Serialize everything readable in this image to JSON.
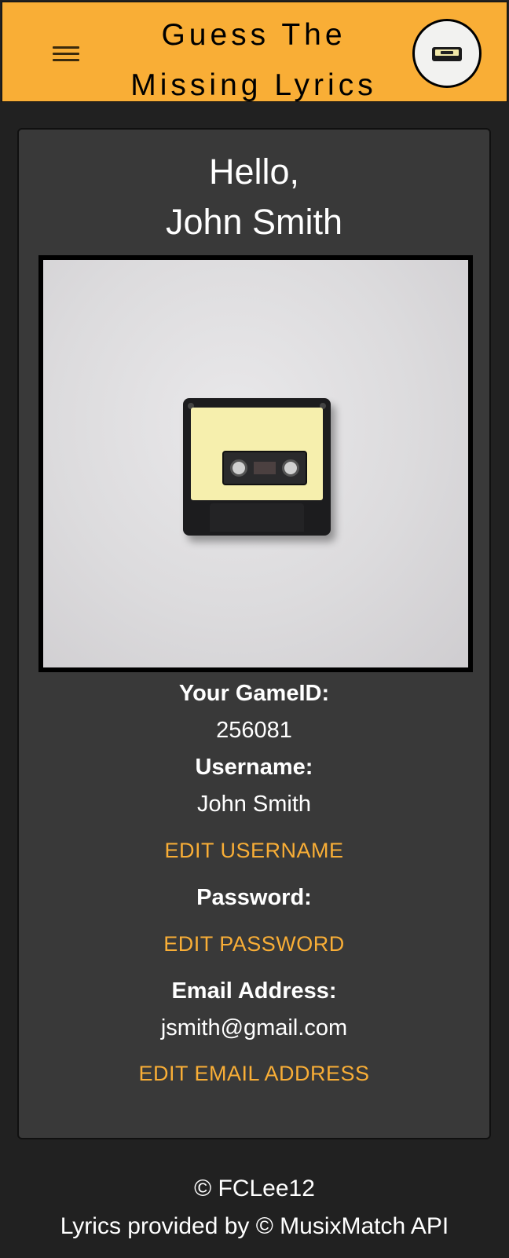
{
  "header": {
    "title_line1": "Guess The",
    "title_line2": "Missing Lyrics",
    "menu_icon": "hamburger-menu-icon",
    "avatar_icon": "cassette-avatar-icon",
    "background_color": "#f9ae36"
  },
  "profile": {
    "greeting_line1": "Hello,",
    "greeting_line2": "John Smith",
    "photo_subject": "cassette-tape-image",
    "gameid_label": "Your GameID:",
    "gameid_value": "256081",
    "username_label": "Username:",
    "username_value": "John Smith",
    "edit_username": "EDIT USERNAME",
    "password_label": "Password:",
    "edit_password": "EDIT PASSWORD",
    "email_label": "Email Address:",
    "email_value": "jsmith@gmail.com",
    "edit_email": "EDIT EMAIL ADDRESS"
  },
  "footer": {
    "copyright": "© FCLee12",
    "credit": "Lyrics provided by © MusixMatch API"
  },
  "colors": {
    "accent": "#f9ae36",
    "page_bg": "#212121",
    "card_bg": "#393939"
  }
}
